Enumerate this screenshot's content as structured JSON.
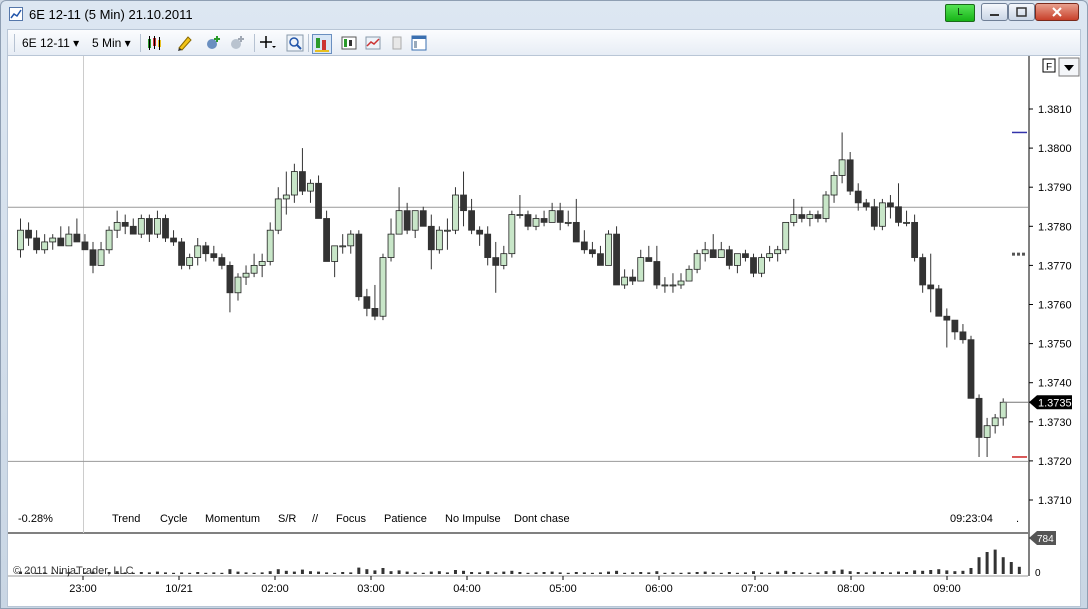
{
  "window": {
    "title": "6E 12-11 (5 Min)  21.10.2011",
    "live_button": "L",
    "colors": {
      "live": "#22c022",
      "bullish": "#c8e6c8",
      "bearish": "#333333"
    }
  },
  "toolbar": {
    "instrument": "6E 12-11",
    "interval": "5 Min",
    "icons": [
      "chart-style-icon",
      "drawing-pencil-icon",
      "indicators-icon",
      "strategies-icon",
      "crosshair-icon",
      "zoom-icon",
      "bar-type-icon",
      "data-box-icon",
      "chart-trader-icon",
      "print-icon",
      "properties-icon"
    ]
  },
  "chart_data": {
    "type": "candlestick",
    "instrument": "6E 12-11",
    "interval": "5 Min",
    "date": "21.10.2011",
    "ylim": [
      1.3702,
      1.3822
    ],
    "yticks": [
      "1.3810",
      "1.3800",
      "1.3790",
      "1.3780",
      "1.3770",
      "1.3760",
      "1.3750",
      "1.3740",
      "1.3730",
      "1.3720",
      "1.3710"
    ],
    "xticks": [
      "23:00",
      "10/21",
      "02:00",
      "03:00",
      "04:00",
      "05:00",
      "06:00",
      "07:00",
      "08:00",
      "09:00"
    ],
    "last_price": "1.3735",
    "last_price_line": 1.3735,
    "horizontal_lines": [
      1.3785,
      1.372
    ],
    "vertical_line_label": "23:00",
    "change_pct": "-0.28%",
    "time_label": "09:23:04",
    "notes": [
      "Trend",
      "Cycle",
      "Momentum",
      "S/R",
      "//",
      "Focus",
      "Patience",
      "No Impulse",
      "Dont chase"
    ],
    "right_markers": [
      {
        "price": 1.3804,
        "color": "#3333aa"
      },
      {
        "price": 1.3773,
        "color": "#555555",
        "style": "dots"
      },
      {
        "price": 1.3721,
        "color": "#cc2222"
      }
    ],
    "volume": {
      "last": "784",
      "zero_label": "0",
      "ymax": 900
    },
    "copyright": "© 2011 NinjaTrader, LLC",
    "candles": [
      [
        1.3774,
        1.3782,
        1.3772,
        1.3779
      ],
      [
        1.3779,
        1.3781,
        1.3775,
        1.3777
      ],
      [
        1.3777,
        1.3779,
        1.3773,
        1.3774
      ],
      [
        1.3774,
        1.3778,
        1.3773,
        1.3776
      ],
      [
        1.3776,
        1.3778,
        1.3774,
        1.3777
      ],
      [
        1.3777,
        1.378,
        1.3775,
        1.3775
      ],
      [
        1.3775,
        1.378,
        1.3775,
        1.3778
      ],
      [
        1.3778,
        1.3782,
        1.3776,
        1.3776
      ],
      [
        1.3776,
        1.3778,
        1.3774,
        1.3774
      ],
      [
        1.3774,
        1.3776,
        1.3768,
        1.377
      ],
      [
        1.377,
        1.3776,
        1.377,
        1.3774
      ],
      [
        1.3774,
        1.378,
        1.3773,
        1.3779
      ],
      [
        1.3779,
        1.3784,
        1.3777,
        1.3781
      ],
      [
        1.3781,
        1.3783,
        1.3778,
        1.378
      ],
      [
        1.378,
        1.3782,
        1.3778,
        1.3778
      ],
      [
        1.3778,
        1.3783,
        1.3777,
        1.3782
      ],
      [
        1.3782,
        1.3783,
        1.3776,
        1.3778
      ],
      [
        1.3778,
        1.3784,
        1.3777,
        1.3782
      ],
      [
        1.3782,
        1.3783,
        1.3776,
        1.3777
      ],
      [
        1.3777,
        1.3779,
        1.3775,
        1.3776
      ],
      [
        1.3776,
        1.3777,
        1.3769,
        1.377
      ],
      [
        1.377,
        1.3773,
        1.3769,
        1.3772
      ],
      [
        1.3772,
        1.3777,
        1.377,
        1.3775
      ],
      [
        1.3775,
        1.3776,
        1.3771,
        1.3773
      ],
      [
        1.3773,
        1.3775,
        1.3771,
        1.3772
      ],
      [
        1.3772,
        1.3773,
        1.3769,
        1.377
      ],
      [
        1.377,
        1.3771,
        1.3758,
        1.3763
      ],
      [
        1.3763,
        1.3768,
        1.3761,
        1.3767
      ],
      [
        1.3767,
        1.377,
        1.3765,
        1.3768
      ],
      [
        1.3768,
        1.3773,
        1.3767,
        1.377
      ],
      [
        1.377,
        1.3773,
        1.3767,
        1.3771
      ],
      [
        1.3771,
        1.3781,
        1.377,
        1.3779
      ],
      [
        1.3779,
        1.379,
        1.3778,
        1.3787
      ],
      [
        1.3787,
        1.3794,
        1.3783,
        1.3788
      ],
      [
        1.3788,
        1.3796,
        1.3786,
        1.3794
      ],
      [
        1.3794,
        1.38,
        1.3788,
        1.3789
      ],
      [
        1.3789,
        1.3792,
        1.3786,
        1.3791
      ],
      [
        1.3791,
        1.3793,
        1.3782,
        1.3782
      ],
      [
        1.3782,
        1.3784,
        1.3771,
        1.3771
      ],
      [
        1.3771,
        1.3775,
        1.3767,
        1.3775
      ],
      [
        1.3775,
        1.3778,
        1.3773,
        1.3775
      ],
      [
        1.3775,
        1.3779,
        1.3773,
        1.3778
      ],
      [
        1.3778,
        1.3779,
        1.3761,
        1.3762
      ],
      [
        1.3762,
        1.3764,
        1.3757,
        1.3759
      ],
      [
        1.3759,
        1.3765,
        1.3756,
        1.3757
      ],
      [
        1.3757,
        1.3773,
        1.3756,
        1.3772
      ],
      [
        1.3772,
        1.3782,
        1.3771,
        1.3778
      ],
      [
        1.3778,
        1.379,
        1.3778,
        1.3784
      ],
      [
        1.3784,
        1.3786,
        1.3778,
        1.3779
      ],
      [
        1.3779,
        1.3784,
        1.3777,
        1.3784
      ],
      [
        1.3784,
        1.3785,
        1.378,
        1.378
      ],
      [
        1.378,
        1.3783,
        1.3769,
        1.3774
      ],
      [
        1.3774,
        1.378,
        1.3773,
        1.3779
      ],
      [
        1.3779,
        1.3782,
        1.3774,
        1.3779
      ],
      [
        1.3779,
        1.379,
        1.3778,
        1.3788
      ],
      [
        1.3788,
        1.3794,
        1.378,
        1.3784
      ],
      [
        1.3784,
        1.3787,
        1.3778,
        1.3779
      ],
      [
        1.3779,
        1.378,
        1.3775,
        1.3778
      ],
      [
        1.3778,
        1.378,
        1.377,
        1.3772
      ],
      [
        1.3772,
        1.3776,
        1.3763,
        1.377
      ],
      [
        1.377,
        1.3775,
        1.3769,
        1.3773
      ],
      [
        1.3773,
        1.3784,
        1.3772,
        1.3783
      ],
      [
        1.3783,
        1.3788,
        1.3782,
        1.3783
      ],
      [
        1.3783,
        1.3784,
        1.3779,
        1.378
      ],
      [
        1.378,
        1.3783,
        1.3779,
        1.3782
      ],
      [
        1.3782,
        1.3784,
        1.378,
        1.3781
      ],
      [
        1.3781,
        1.3786,
        1.3781,
        1.3784
      ],
      [
        1.3784,
        1.3786,
        1.3779,
        1.3781
      ],
      [
        1.3781,
        1.3784,
        1.378,
        1.3781
      ],
      [
        1.3781,
        1.3787,
        1.3776,
        1.3776
      ],
      [
        1.3776,
        1.3779,
        1.3773,
        1.3774
      ],
      [
        1.3774,
        1.3776,
        1.3772,
        1.3773
      ],
      [
        1.3773,
        1.3775,
        1.377,
        1.377
      ],
      [
        1.377,
        1.3779,
        1.377,
        1.3778
      ],
      [
        1.3778,
        1.378,
        1.3765,
        1.3765
      ],
      [
        1.3765,
        1.3769,
        1.3764,
        1.3767
      ],
      [
        1.3767,
        1.3769,
        1.3765,
        1.3766
      ],
      [
        1.3766,
        1.3774,
        1.3766,
        1.3772
      ],
      [
        1.3772,
        1.3775,
        1.3771,
        1.3771
      ],
      [
        1.3771,
        1.3775,
        1.3764,
        1.3765
      ],
      [
        1.3765,
        1.3767,
        1.3763,
        1.3765
      ],
      [
        1.3765,
        1.3768,
        1.3763,
        1.3765
      ],
      [
        1.3765,
        1.3768,
        1.3764,
        1.3766
      ],
      [
        1.3766,
        1.377,
        1.3766,
        1.3769
      ],
      [
        1.3769,
        1.3774,
        1.3768,
        1.3773
      ],
      [
        1.3773,
        1.3776,
        1.3771,
        1.3774
      ],
      [
        1.3774,
        1.3778,
        1.3772,
        1.3772
      ],
      [
        1.3772,
        1.3776,
        1.3772,
        1.3774
      ],
      [
        1.3774,
        1.3775,
        1.3769,
        1.377
      ],
      [
        1.377,
        1.3773,
        1.3768,
        1.3773
      ],
      [
        1.3773,
        1.3774,
        1.3771,
        1.3772
      ],
      [
        1.3772,
        1.3773,
        1.3767,
        1.3768
      ],
      [
        1.3768,
        1.3773,
        1.3767,
        1.3772
      ],
      [
        1.3772,
        1.3775,
        1.3771,
        1.3773
      ],
      [
        1.3773,
        1.3775,
        1.3771,
        1.3774
      ],
      [
        1.3774,
        1.3781,
        1.3773,
        1.3781
      ],
      [
        1.3781,
        1.3787,
        1.378,
        1.3783
      ],
      [
        1.3783,
        1.3785,
        1.3781,
        1.3782
      ],
      [
        1.3782,
        1.3784,
        1.378,
        1.3783
      ],
      [
        1.3783,
        1.3784,
        1.3781,
        1.3782
      ],
      [
        1.3782,
        1.3789,
        1.3781,
        1.3788
      ],
      [
        1.3788,
        1.3794,
        1.3786,
        1.3793
      ],
      [
        1.3793,
        1.3804,
        1.3791,
        1.3797
      ],
      [
        1.3797,
        1.3799,
        1.3788,
        1.3789
      ],
      [
        1.3789,
        1.3791,
        1.3784,
        1.3786
      ],
      [
        1.3786,
        1.3787,
        1.3784,
        1.3785
      ],
      [
        1.3785,
        1.3787,
        1.3779,
        1.378
      ],
      [
        1.378,
        1.3787,
        1.3779,
        1.3786
      ],
      [
        1.3786,
        1.3788,
        1.3782,
        1.3785
      ],
      [
        1.3785,
        1.3791,
        1.378,
        1.3781
      ],
      [
        1.3781,
        1.3784,
        1.378,
        1.3781
      ],
      [
        1.3781,
        1.3783,
        1.3771,
        1.3772
      ],
      [
        1.3772,
        1.3773,
        1.3763,
        1.3765
      ],
      [
        1.3765,
        1.3773,
        1.3758,
        1.3764
      ],
      [
        1.3764,
        1.3765,
        1.3757,
        1.3757
      ],
      [
        1.3757,
        1.3759,
        1.3749,
        1.3756
      ],
      [
        1.3756,
        1.3756,
        1.3751,
        1.3753
      ],
      [
        1.3753,
        1.3755,
        1.375,
        1.3751
      ],
      [
        1.3751,
        1.3752,
        1.3736,
        1.3736
      ],
      [
        1.3736,
        1.3737,
        1.3721,
        1.3726
      ],
      [
        1.3726,
        1.3731,
        1.3721,
        1.3729
      ],
      [
        1.3729,
        1.3732,
        1.3727,
        1.3731
      ],
      [
        1.3731,
        1.3736,
        1.3729,
        1.3735
      ]
    ],
    "volumes": [
      60,
      40,
      30,
      40,
      30,
      40,
      50,
      30,
      40,
      60,
      30,
      50,
      70,
      40,
      30,
      50,
      40,
      60,
      40,
      30,
      40,
      30,
      50,
      30,
      40,
      30,
      120,
      60,
      40,
      30,
      40,
      70,
      120,
      80,
      60,
      110,
      70,
      60,
      40,
      30,
      50,
      40,
      160,
      120,
      90,
      150,
      70,
      90,
      60,
      40,
      30,
      60,
      70,
      40,
      100,
      80,
      50,
      40,
      70,
      40,
      60,
      80,
      50,
      30,
      40,
      50,
      60,
      40,
      30,
      50,
      40,
      30,
      40,
      60,
      80,
      30,
      40,
      50,
      40,
      70,
      30,
      40,
      30,
      40,
      50,
      60,
      40,
      30,
      50,
      30,
      40,
      70,
      40,
      30,
      60,
      80,
      50,
      40,
      30,
      40,
      70,
      80,
      110,
      70,
      50,
      40,
      60,
      50,
      40,
      60,
      50,
      90,
      80,
      100,
      120,
      90,
      70,
      80,
      150,
      420,
      550,
      610,
      420,
      300,
      180
    ]
  }
}
